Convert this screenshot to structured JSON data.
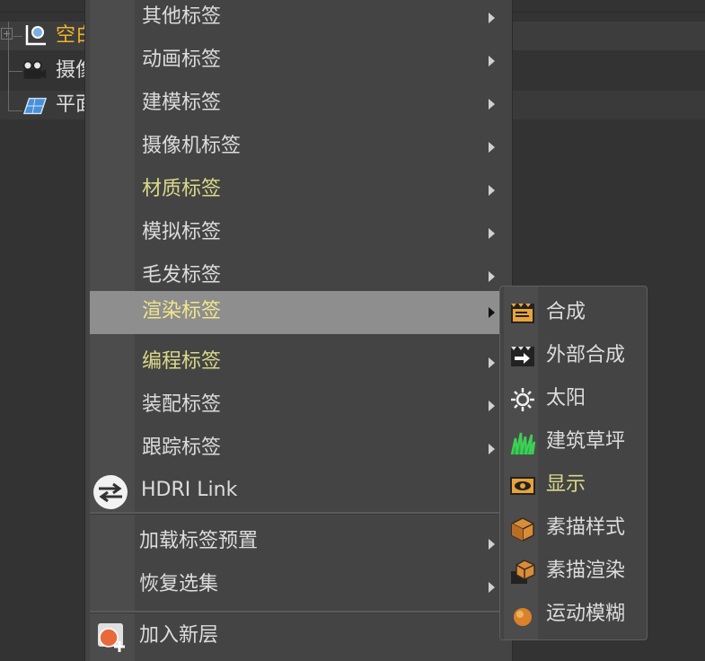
{
  "tree": {
    "items": [
      {
        "label": "空白",
        "color": "#f0b429",
        "icon": "null-object-icon"
      },
      {
        "label": "摄像",
        "color": "#dcdcdc",
        "icon": "camera-icon"
      },
      {
        "label": "平面",
        "color": "#dcdcdc",
        "icon": "plane-icon"
      }
    ]
  },
  "menu": {
    "items": [
      {
        "label": "其他标签",
        "submenu": true,
        "highlight": false
      },
      {
        "label": "动画标签",
        "submenu": true,
        "highlight": false
      },
      {
        "label": "建模标签",
        "submenu": true,
        "highlight": false
      },
      {
        "label": "摄像机标签",
        "submenu": true,
        "highlight": false
      },
      {
        "label": "材质标签",
        "submenu": true,
        "highlight": true
      },
      {
        "label": "模拟标签",
        "submenu": true,
        "highlight": false
      },
      {
        "label": "毛发标签",
        "submenu": true,
        "highlight": false
      },
      {
        "label": "渲染标签",
        "submenu": true,
        "highlight": true,
        "active": true
      },
      {
        "label": "编程标签",
        "submenu": true,
        "highlight": true
      },
      {
        "label": "装配标签",
        "submenu": true,
        "highlight": false
      },
      {
        "label": "跟踪标签",
        "submenu": true,
        "highlight": false
      },
      {
        "label": "HDRI Link",
        "icon": "hdri-link-icon"
      }
    ],
    "items2": [
      {
        "label": "加载标签预置",
        "submenu": true
      },
      {
        "label": "恢复选集",
        "submenu": true
      }
    ],
    "items3": [
      {
        "label": "加入新层",
        "icon": "add-layer-icon"
      }
    ]
  },
  "submenu": {
    "items": [
      {
        "label": "合成",
        "icon": "compositing-tag-icon",
        "highlight": false
      },
      {
        "label": "外部合成",
        "icon": "external-compositing-icon",
        "highlight": false
      },
      {
        "label": "太阳",
        "icon": "sun-icon",
        "highlight": false
      },
      {
        "label": "建筑草坪",
        "icon": "grass-icon",
        "highlight": false
      },
      {
        "label": "显示",
        "icon": "display-eye-icon",
        "highlight": true
      },
      {
        "label": "素描样式",
        "icon": "sketch-style-icon",
        "highlight": false
      },
      {
        "label": "素描渲染",
        "icon": "sketch-render-icon",
        "highlight": false
      },
      {
        "label": "运动模糊",
        "icon": "motion-blur-icon",
        "highlight": false
      }
    ]
  },
  "colors": {
    "highlight_text": "#d9d98a",
    "active_row": "#8e8e8e",
    "menu_bg": "#444444"
  }
}
